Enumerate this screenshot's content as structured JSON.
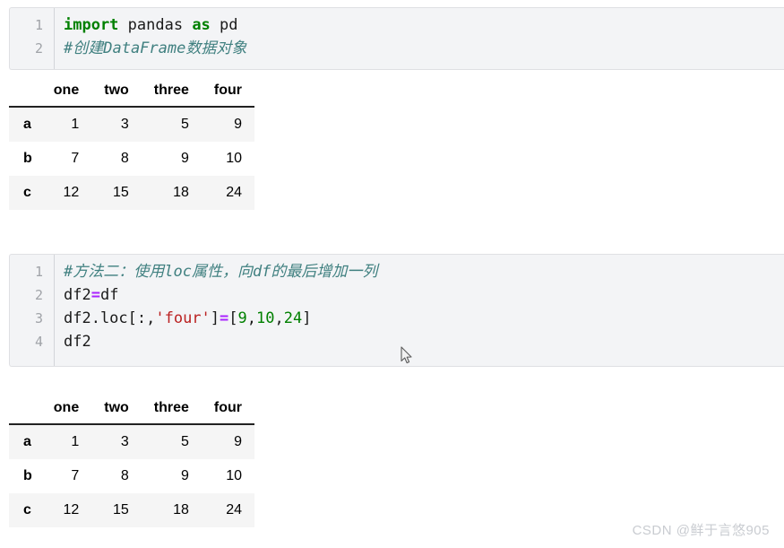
{
  "cells": [
    {
      "id": "cell-1",
      "line_numbers": [
        "1",
        "2"
      ],
      "lines": [
        {
          "tokens": [
            {
              "text": "import",
              "type": "keyword"
            },
            {
              "text": " pandas ",
              "type": "plain"
            },
            {
              "text": "as",
              "type": "keyword"
            },
            {
              "text": " pd",
              "type": "plain"
            }
          ]
        },
        {
          "tokens": [
            {
              "text": "#创建DataFrame数据对象",
              "type": "comment"
            }
          ]
        }
      ]
    },
    {
      "id": "cell-2",
      "line_numbers": [
        "1",
        "2",
        "3",
        "4"
      ],
      "lines": [
        {
          "tokens": [
            {
              "text": "#方法二：使用loc属性，向df的最后增加一列",
              "type": "comment"
            }
          ]
        },
        {
          "tokens": [
            {
              "text": "df2",
              "type": "plain"
            },
            {
              "text": "=",
              "type": "operator"
            },
            {
              "text": "df",
              "type": "plain"
            }
          ]
        },
        {
          "tokens": [
            {
              "text": "df2.loc[:,",
              "type": "plain"
            },
            {
              "text": "'four'",
              "type": "string"
            },
            {
              "text": "]",
              "type": "plain"
            },
            {
              "text": "=",
              "type": "operator"
            },
            {
              "text": "[",
              "type": "plain"
            },
            {
              "text": "9",
              "type": "number"
            },
            {
              "text": ",",
              "type": "plain"
            },
            {
              "text": "10",
              "type": "number"
            },
            {
              "text": ",",
              "type": "plain"
            },
            {
              "text": "24",
              "type": "number"
            },
            {
              "text": "]",
              "type": "plain"
            }
          ]
        },
        {
          "tokens": [
            {
              "text": "df2",
              "type": "plain"
            }
          ]
        }
      ]
    }
  ],
  "tables": [
    {
      "id": "dataframe-output-1",
      "index_header": "",
      "columns": [
        "one",
        "two",
        "three",
        "four"
      ],
      "index": [
        "a",
        "b",
        "c"
      ],
      "rows": [
        [
          "1",
          "3",
          "5",
          "9"
        ],
        [
          "7",
          "8",
          "9",
          "10"
        ],
        [
          "12",
          "15",
          "18",
          "24"
        ]
      ]
    },
    {
      "id": "dataframe-output-2",
      "index_header": "",
      "columns": [
        "one",
        "two",
        "three",
        "four"
      ],
      "index": [
        "a",
        "b",
        "c"
      ],
      "rows": [
        [
          "1",
          "3",
          "5",
          "9"
        ],
        [
          "7",
          "8",
          "9",
          "10"
        ],
        [
          "12",
          "15",
          "18",
          "24"
        ]
      ]
    }
  ],
  "watermark": {
    "text": "CSDN @鲜于言悠905"
  },
  "colors": {
    "cell_background": "#f3f4f6",
    "cell_border": "#dfe0e3",
    "gutter_text": "#a0a3a8",
    "keyword": "#008000",
    "comment": "#408080",
    "string": "#ba2121",
    "operator": "#aa22ff",
    "number": "#008000",
    "table_stripe": "#f5f5f5",
    "watermark": "#c9ccd1"
  }
}
